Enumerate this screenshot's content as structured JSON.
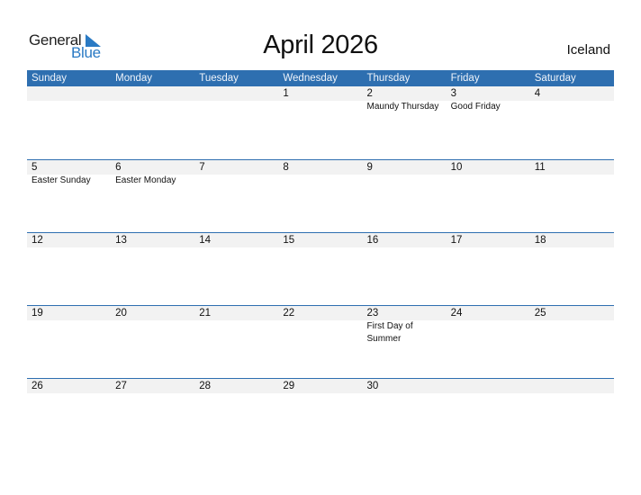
{
  "logo": {
    "word1": "General",
    "word2": "Blue",
    "accent_color": "#2a7ac4"
  },
  "header": {
    "title": "April 2026",
    "country": "Iceland"
  },
  "colors": {
    "header_bg": "#2e6fb0",
    "row_band": "#f2f2f2"
  },
  "weekdays": [
    "Sunday",
    "Monday",
    "Tuesday",
    "Wednesday",
    "Thursday",
    "Friday",
    "Saturday"
  ],
  "weeks": [
    [
      {
        "day": "",
        "holiday": ""
      },
      {
        "day": "",
        "holiday": ""
      },
      {
        "day": "",
        "holiday": ""
      },
      {
        "day": "1",
        "holiday": ""
      },
      {
        "day": "2",
        "holiday": "Maundy Thursday"
      },
      {
        "day": "3",
        "holiday": "Good Friday"
      },
      {
        "day": "4",
        "holiday": ""
      }
    ],
    [
      {
        "day": "5",
        "holiday": "Easter Sunday"
      },
      {
        "day": "6",
        "holiday": "Easter Monday"
      },
      {
        "day": "7",
        "holiday": ""
      },
      {
        "day": "8",
        "holiday": ""
      },
      {
        "day": "9",
        "holiday": ""
      },
      {
        "day": "10",
        "holiday": ""
      },
      {
        "day": "11",
        "holiday": ""
      }
    ],
    [
      {
        "day": "12",
        "holiday": ""
      },
      {
        "day": "13",
        "holiday": ""
      },
      {
        "day": "14",
        "holiday": ""
      },
      {
        "day": "15",
        "holiday": ""
      },
      {
        "day": "16",
        "holiday": ""
      },
      {
        "day": "17",
        "holiday": ""
      },
      {
        "day": "18",
        "holiday": ""
      }
    ],
    [
      {
        "day": "19",
        "holiday": ""
      },
      {
        "day": "20",
        "holiday": ""
      },
      {
        "day": "21",
        "holiday": ""
      },
      {
        "day": "22",
        "holiday": ""
      },
      {
        "day": "23",
        "holiday": "First Day of Summer"
      },
      {
        "day": "24",
        "holiday": ""
      },
      {
        "day": "25",
        "holiday": ""
      }
    ],
    [
      {
        "day": "26",
        "holiday": ""
      },
      {
        "day": "27",
        "holiday": ""
      },
      {
        "day": "28",
        "holiday": ""
      },
      {
        "day": "29",
        "holiday": ""
      },
      {
        "day": "30",
        "holiday": ""
      },
      {
        "day": "",
        "holiday": ""
      },
      {
        "day": "",
        "holiday": ""
      }
    ]
  ]
}
